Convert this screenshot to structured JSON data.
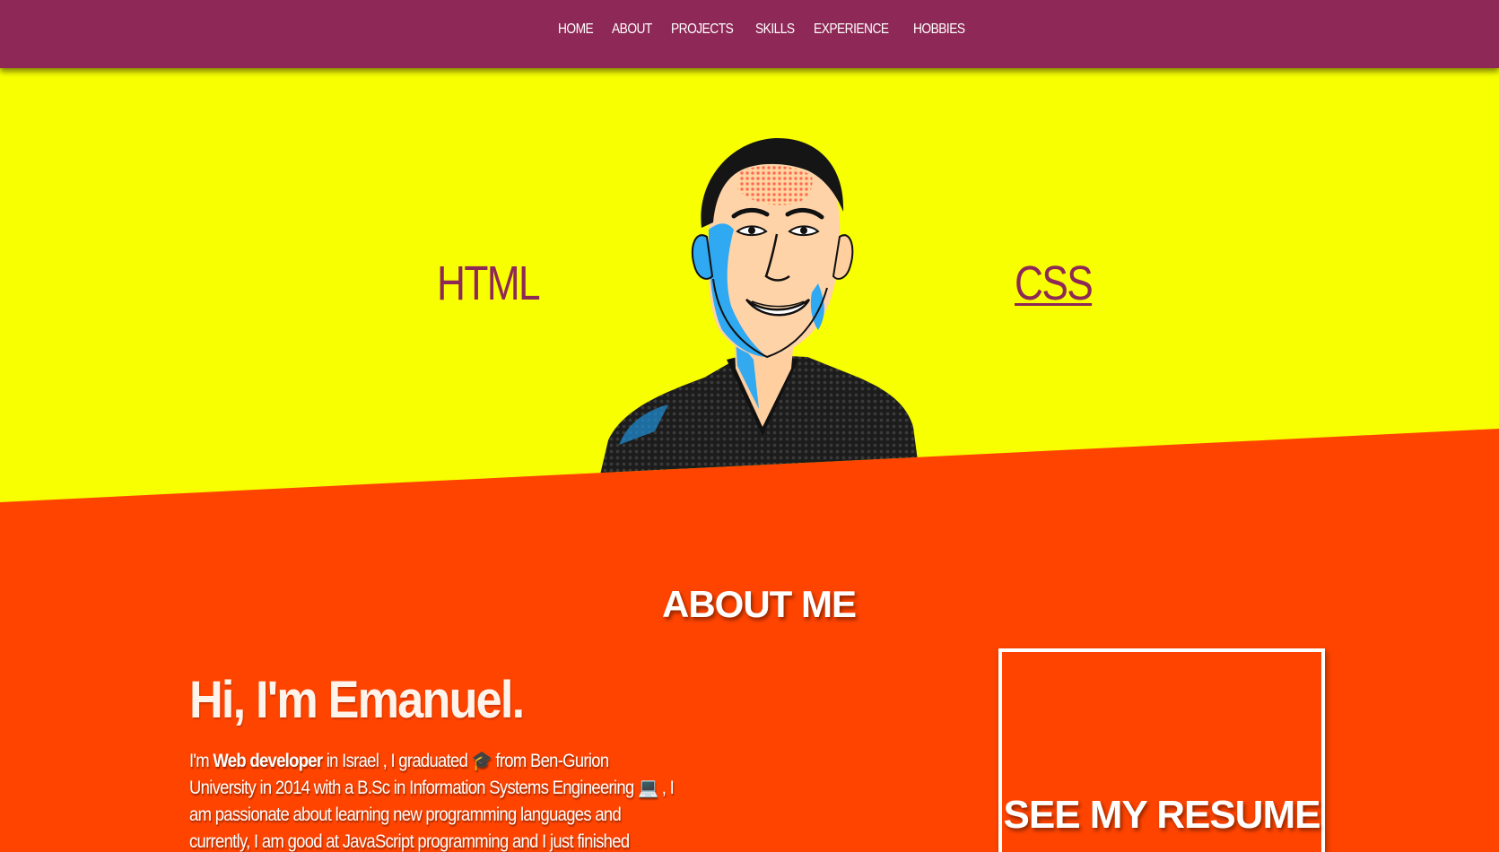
{
  "nav": {
    "items": [
      {
        "label": "HOME"
      },
      {
        "label": "ABOUT"
      },
      {
        "label": "PROJECTS"
      },
      {
        "label": "SKILLS"
      },
      {
        "label": "EXPERIENCE"
      },
      {
        "label": "HOBBIES"
      }
    ]
  },
  "hero": {
    "left_word": "HTML",
    "right_word": "CSS"
  },
  "about": {
    "title": "ABOUT ME",
    "greeting": "Hi, I'm Emanuel.",
    "bio": {
      "prefix": "I'm ",
      "role": "Web developer",
      "part1": " in Israel , I graduated ",
      "grad_emoji": "🎓",
      "part2": " from Ben-Gurion University in 2014 with a B.Sc in Information Systems Engineering ",
      "laptop_emoji": "💻",
      "part3": " , I am passionate about learning new programming languages and currently, I am good at JavaScript programming and I just finished learning MERN Stack."
    },
    "resume_button": "SEE MY RESUME"
  },
  "colors": {
    "nav_bg": "#8e2856",
    "hero_bg": "#f7ff00",
    "about_bg": "#ff4400",
    "accent_text": "#8e2856"
  }
}
